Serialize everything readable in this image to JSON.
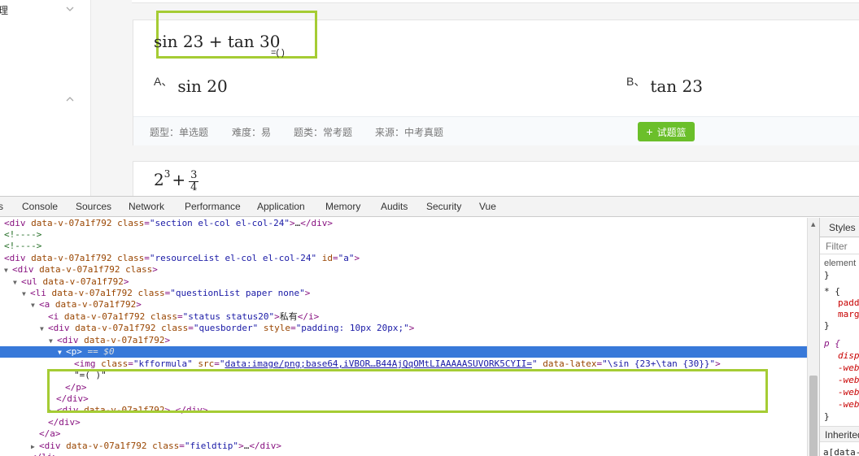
{
  "sidebar": {
    "section_label": "理",
    "chevrons": [
      "chevron-down-icon",
      "chevron-up-icon"
    ]
  },
  "question": {
    "formula": "sin 23 + tan 30",
    "suffix": "=( )",
    "options": [
      {
        "letter": "A、",
        "formula": "sin 20"
      },
      {
        "letter": "B、",
        "formula": "tan 23"
      }
    ],
    "meta": {
      "type": "题型：单选题",
      "difficulty": "难度：易",
      "category": "题类：常考题",
      "source": "来源：中考真题"
    },
    "add_button": {
      "icon": "+",
      "label": "试题篮"
    }
  },
  "question2": {
    "base": "2",
    "exponent": "3",
    "plus": "+",
    "numerator": "3",
    "denominator": "4"
  },
  "devtools": {
    "tabs": [
      "s",
      "Console",
      "Sources",
      "Network",
      "Performance",
      "Application",
      "Memory",
      "Audits",
      "Security",
      "Vue"
    ],
    "styles_panel": {
      "tab": "Styles",
      "filter_placeholder": "Filter",
      "lines": [
        "element",
        "}",
        "* {",
        "padd",
        "marg",
        "}",
        "p {",
        "disp",
        "-web",
        "-web",
        "-web",
        "-web",
        "}"
      ],
      "inherited": "Inherited",
      "inherited_rule": "a[data-"
    }
  },
  "colors": {
    "accent_green": "#a5cc34",
    "button_green": "#6bbf2a",
    "selection_blue": "#3879d9"
  }
}
